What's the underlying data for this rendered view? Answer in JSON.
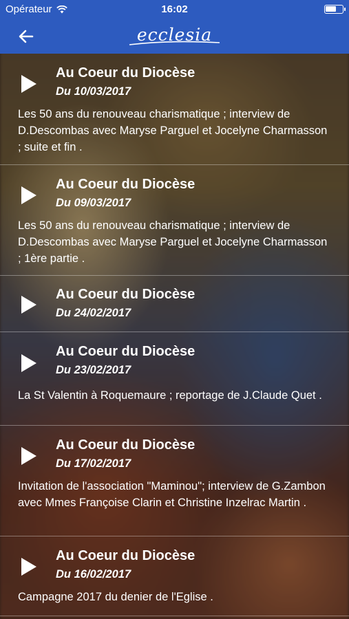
{
  "status_bar": {
    "carrier": "Opérateur",
    "time": "16:02"
  },
  "header": {
    "logo_text": "ecclesia",
    "back_icon": "arrow-left-icon"
  },
  "colors": {
    "header": "#2d5bbf",
    "text": "#ffffff"
  },
  "items": [
    {
      "title": "Au Coeur du Diocèse",
      "date": "Du 10/03/2017",
      "description": "Les 50 ans du renouveau charismatique ; interview de D.Descombas avec Maryse Parguel et Jocelyne Charmasson ; suite et fin ."
    },
    {
      "title": "Au Coeur du Diocèse",
      "date": "Du 09/03/2017",
      "description": "Les 50 ans du renouveau charismatique ; interview de D.Descombas avec Maryse Parguel et Jocelyne Charmasson ; 1ère partie ."
    },
    {
      "title": "Au Coeur du Diocèse",
      "date": "Du 24/02/2017",
      "description": ""
    },
    {
      "title": "Au Coeur du Diocèse",
      "date": "Du 23/02/2017",
      "description": "La St Valentin à Roquemaure ; reportage de J.Claude Quet ."
    },
    {
      "title": "Au Coeur du Diocèse",
      "date": "Du 17/02/2017",
      "description": "Invitation de l'association \"Maminou\"; interview de G.Zambon avec Mmes Françoise Clarin et Christine Inzelrac Martin ."
    },
    {
      "title": "Au Coeur du Diocèse",
      "date": "Du 16/02/2017",
      "description": "Campagne 2017 du denier de l'Eglise ."
    }
  ]
}
